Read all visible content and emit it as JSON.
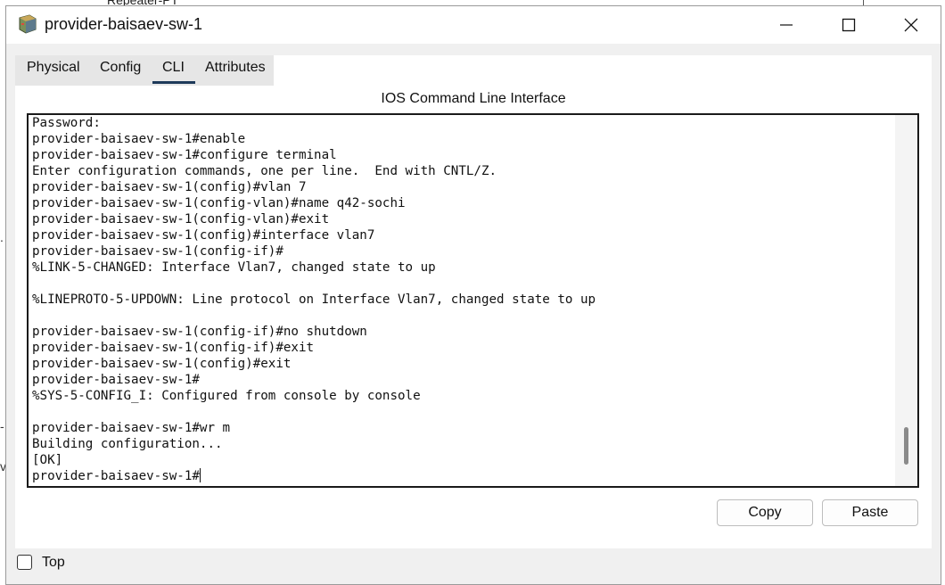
{
  "background": {
    "partial_text": "Repeater-PT"
  },
  "window": {
    "title": "provider-baisaev-sw-1",
    "icon": "switch-icon",
    "controls": {
      "minimize": "minimize-icon",
      "maximize": "maximize-icon",
      "close": "close-icon"
    }
  },
  "tabs": [
    {
      "label": "Physical",
      "active": false
    },
    {
      "label": "Config",
      "active": false
    },
    {
      "label": "CLI",
      "active": true
    },
    {
      "label": "Attributes",
      "active": false
    }
  ],
  "cli": {
    "heading": "IOS Command Line Interface",
    "lines": [
      "Password:",
      "provider-baisaev-sw-1#enable",
      "provider-baisaev-sw-1#configure terminal",
      "Enter configuration commands, one per line.  End with CNTL/Z.",
      "provider-baisaev-sw-1(config)#vlan 7",
      "provider-baisaev-sw-1(config-vlan)#name q42-sochi",
      "provider-baisaev-sw-1(config-vlan)#exit",
      "provider-baisaev-sw-1(config)#interface vlan7",
      "provider-baisaev-sw-1(config-if)#",
      "%LINK-5-CHANGED: Interface Vlan7, changed state to up",
      "",
      "%LINEPROTO-5-UPDOWN: Line protocol on Interface Vlan7, changed state to up",
      "",
      "provider-baisaev-sw-1(config-if)#no shutdown",
      "provider-baisaev-sw-1(config-if)#exit",
      "provider-baisaev-sw-1(config)#exit",
      "provider-baisaev-sw-1#",
      "%SYS-5-CONFIG_I: Configured from console by console",
      "",
      "provider-baisaev-sw-1#wr m",
      "Building configuration...",
      "[OK]",
      "provider-baisaev-sw-1#"
    ]
  },
  "buttons": {
    "copy": "Copy",
    "paste": "Paste"
  },
  "top_checkbox": {
    "label": "Top",
    "checked": false
  },
  "colors": {
    "tab_underline": "#1e3a5a",
    "window_bg": "#f0f0f0"
  }
}
